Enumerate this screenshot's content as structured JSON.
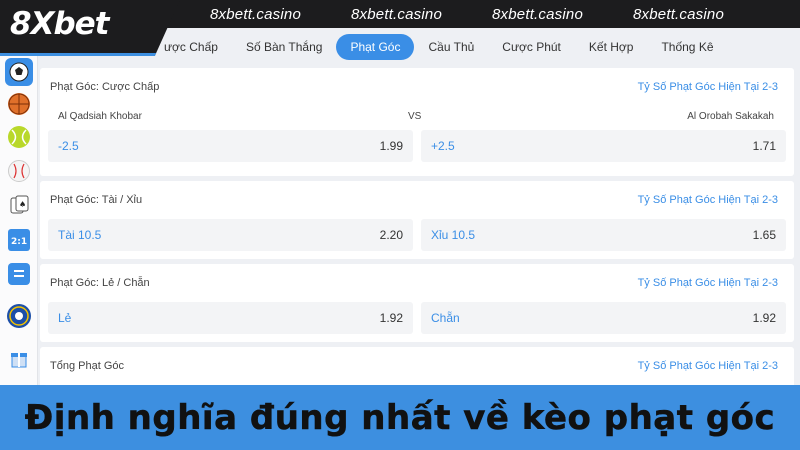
{
  "header": {
    "logo_text": "8Xbet",
    "sites": [
      "8xbett.casino",
      "8xbett.casino",
      "8xbett.casino",
      "8xbett.casino"
    ]
  },
  "tabs": [
    {
      "label": "ược Chấp"
    },
    {
      "label": "Số Bàn Thắng"
    },
    {
      "label": "Phạt Góc",
      "active": true
    },
    {
      "label": "Cầu Thủ"
    },
    {
      "label": "Cược Phút"
    },
    {
      "label": "Kết Hợp"
    },
    {
      "label": "Thống Kê"
    }
  ],
  "sidebar_icons": [
    "soccer-icon",
    "basketball-icon",
    "tennis-icon",
    "baseball-icon",
    "cards-icon",
    "scoreboard-icon",
    "list-icon",
    "club-crest-icon",
    "gift-icon"
  ],
  "sections": [
    {
      "title": "Phạt Góc: Cược Chấp",
      "right": "Tỷ Số Phạt Góc Hiện Tại  2-3",
      "teams": {
        "home": "Al Qadsiah Khobar",
        "vs": "VS",
        "away": "Al Orobah Sakakah"
      },
      "odds": [
        {
          "label": "-2.5",
          "value": "1.99"
        },
        {
          "label": "+2.5",
          "value": "1.71"
        }
      ]
    },
    {
      "title": "Phạt Góc: Tài / Xỉu",
      "right": "Tỷ Số Phạt Góc Hiện Tại  2-3",
      "odds": [
        {
          "label": "Tài 10.5",
          "value": "2.20"
        },
        {
          "label": "Xỉu 10.5",
          "value": "1.65"
        }
      ]
    },
    {
      "title": "Phạt Góc: Lẻ / Chẵn",
      "right": "Tỷ Số Phạt Góc Hiện Tại  2-3",
      "odds": [
        {
          "label": "Lẻ",
          "value": "1.92"
        },
        {
          "label": "Chẵn",
          "value": "1.92"
        }
      ]
    },
    {
      "title": "Tổng Phạt Góc",
      "right": "Tỷ Số Phạt Góc Hiện Tại  2-3"
    }
  ],
  "caption": "Định nghĩa đúng nhất về kèo phạt góc",
  "colors": {
    "accent": "#3a8ee6",
    "banner": "#1c1c1e",
    "caption_bg": "#3d8fe0"
  }
}
